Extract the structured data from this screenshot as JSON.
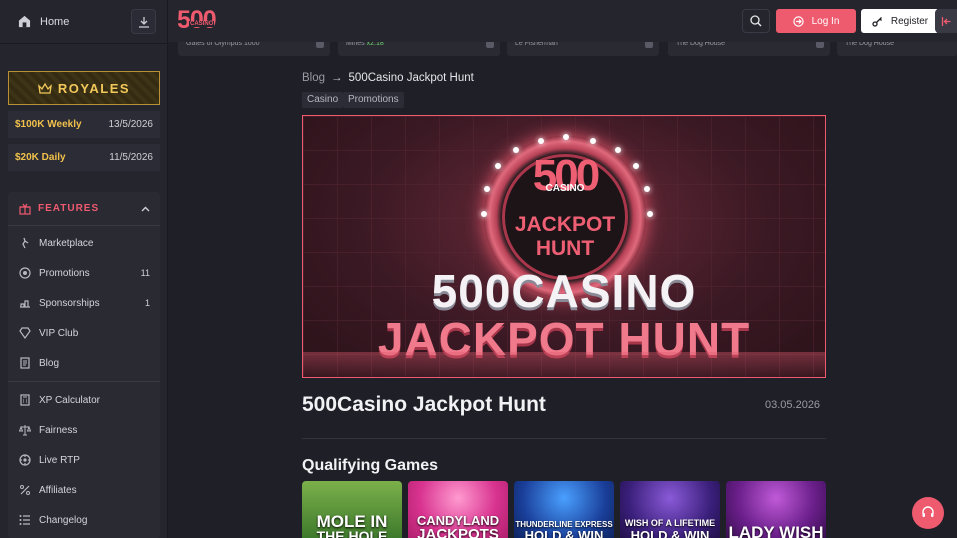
{
  "sidebar": {
    "home_label": "Home",
    "royales_label": "ROYALES",
    "promos": [
      {
        "name": "$100K Weekly",
        "date": "13/5/2026"
      },
      {
        "name": "$20K Daily",
        "date": "11/5/2026"
      }
    ],
    "features_label": "FEATURES",
    "items": [
      {
        "label": "Marketplace",
        "count": ""
      },
      {
        "label": "Promotions",
        "count": "11"
      },
      {
        "label": "Sponsorships",
        "count": "1"
      },
      {
        "label": "VIP Club",
        "count": ""
      },
      {
        "label": "Blog",
        "count": ""
      },
      {
        "label": "XP Calculator",
        "count": ""
      },
      {
        "label": "Fairness",
        "count": ""
      },
      {
        "label": "Live RTP",
        "count": ""
      },
      {
        "label": "Affiliates",
        "count": ""
      },
      {
        "label": "Changelog",
        "count": ""
      }
    ]
  },
  "header": {
    "logo_number": "500",
    "logo_word": "CASINO",
    "login_label": "Log In",
    "register_label": "Register"
  },
  "recent_bets": [
    {
      "game": "Gates of Olympus 1000",
      "mult": ""
    },
    {
      "game": "Mines",
      "mult": "x2.18"
    },
    {
      "game": "Le Fisherman",
      "mult": ""
    },
    {
      "game": "The Dog House",
      "mult": ""
    },
    {
      "game": "The Dog House",
      "mult": ""
    }
  ],
  "breadcrumb": {
    "parent": "Blog",
    "current": "500Casino Jackpot Hunt"
  },
  "tags": [
    "Casino",
    "Promotions"
  ],
  "hero": {
    "wheel_number": "500",
    "wheel_casino": "CASINO",
    "wheel_jackpot": "JACKPOT",
    "wheel_hunt": "HUNT",
    "line1": "500CASINO",
    "line2": "JACKPOT HUNT"
  },
  "article": {
    "title": "500Casino Jackpot Hunt",
    "date": "03.05.2026"
  },
  "qualifying": {
    "title": "Qualifying Games",
    "games": [
      {
        "l1": "MOLE IN",
        "l2": "THE HOLE"
      },
      {
        "l1": "CANDYLAND",
        "l2": "JACKPOTS"
      },
      {
        "l1": "THUNDERLINE EXPRESS",
        "l2": "HOLD & WIN"
      },
      {
        "l1": "WISH OF A LIFETIME",
        "l2": "HOLD & WIN"
      },
      {
        "l1": "LADY WISH",
        "l2": ""
      }
    ]
  },
  "colors": {
    "accent": "#ee5a6e",
    "gold": "#f1c14b",
    "background": "#1f1f27"
  }
}
